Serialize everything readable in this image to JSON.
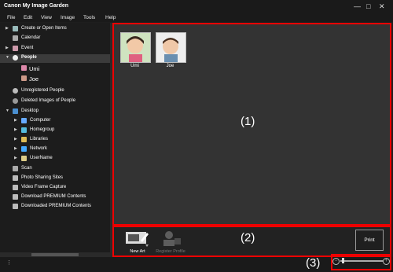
{
  "app": {
    "title": "Canon My Image Garden",
    "window_controls": {
      "minimize": "—",
      "maximize": "□",
      "close": "✕"
    }
  },
  "menu": [
    "File",
    "Edit",
    "View",
    "Image",
    "Tools",
    "Help"
  ],
  "sidebar": {
    "items": [
      {
        "label": "Create or Open Items",
        "icon": "create-items-icon"
      },
      {
        "label": "Calendar",
        "icon": "calendar-icon"
      },
      {
        "label": "Event",
        "icon": "event-icon"
      },
      {
        "label": "People",
        "icon": "people-icon",
        "selected": true
      },
      {
        "label": "Umi",
        "icon": "person-photo-icon"
      },
      {
        "label": "Joe",
        "icon": "person-photo-icon"
      },
      {
        "label": "Unregistered People",
        "icon": "unregistered-people-icon"
      },
      {
        "label": "Deleted Images of People",
        "icon": "deleted-people-icon"
      },
      {
        "label": "Desktop",
        "icon": "folder-icon"
      },
      {
        "label": "Computer",
        "icon": "computer-icon"
      },
      {
        "label": "Homegroup",
        "icon": "homegroup-icon"
      },
      {
        "label": "Libraries",
        "icon": "libraries-icon"
      },
      {
        "label": "Network",
        "icon": "network-icon"
      },
      {
        "label": "UserName",
        "icon": "user-folder-icon"
      },
      {
        "label": "Scan",
        "icon": "scan-icon"
      },
      {
        "label": "Photo Sharing Sites",
        "icon": "photo-sharing-icon"
      },
      {
        "label": "Video Frame Capture",
        "icon": "video-capture-icon"
      },
      {
        "label": "Download PREMIUM Contents",
        "icon": "download-icon"
      },
      {
        "label": "Downloaded PREMIUM Contents",
        "icon": "downloaded-icon"
      }
    ]
  },
  "people": [
    {
      "name": "Umi"
    },
    {
      "name": "Joe"
    }
  ],
  "bottom_panel": {
    "new_art_label": "New Art",
    "register_profile_label": "Register Profile",
    "print_label": "Print"
  },
  "callouts": {
    "one": "(1)",
    "two": "(2)",
    "three": "(3)"
  },
  "zoom": {
    "minus": "−",
    "plus": "+",
    "level": 0.05
  },
  "colors": {
    "highlight": "#e00000",
    "background": "#1e1e1e",
    "content": "#333333"
  }
}
